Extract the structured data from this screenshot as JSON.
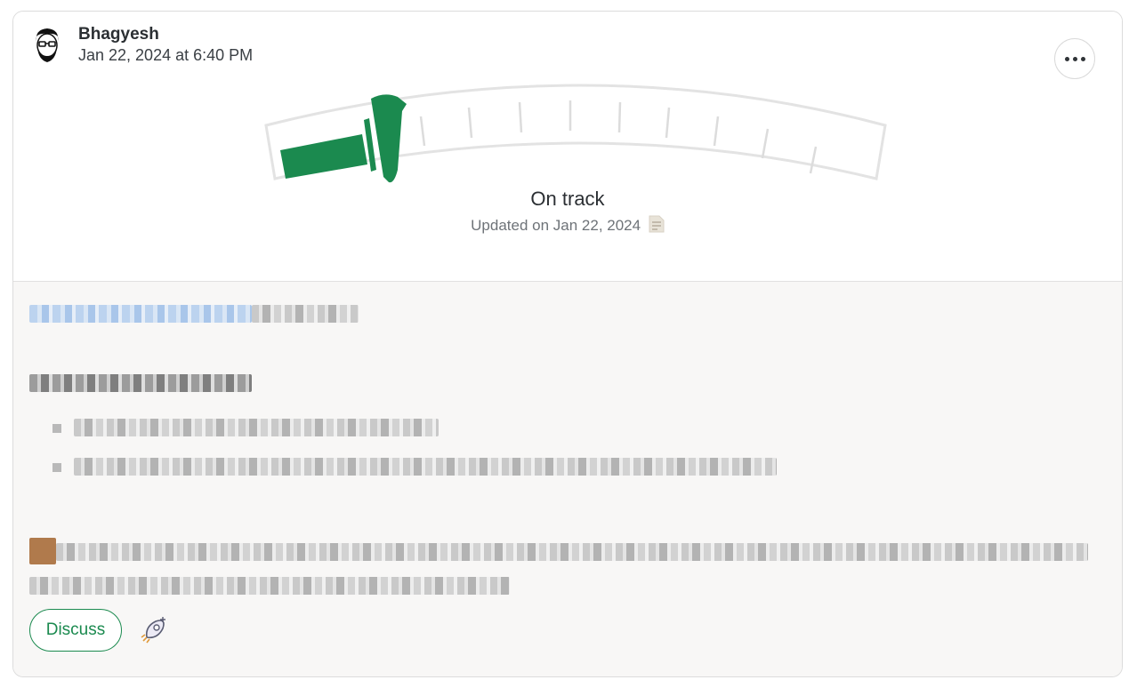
{
  "post": {
    "author": "Bhagyesh",
    "datetime": "Jan 22, 2024 at 6:40 PM",
    "more_label": "More options"
  },
  "status": {
    "label": "On track",
    "updated": "Updated on Jan 22, 2024",
    "gauge_level": 0.18,
    "color": "#1b8a4f"
  },
  "actions": {
    "discuss_label": "Discuss"
  },
  "icons": [
    "avatar",
    "more-icon",
    "gauge",
    "note-icon",
    "rocket-icon"
  ],
  "colors": {
    "accent": "#1b8a4f",
    "body_bg": "#f8f7f6",
    "text": "#2b2f33"
  }
}
